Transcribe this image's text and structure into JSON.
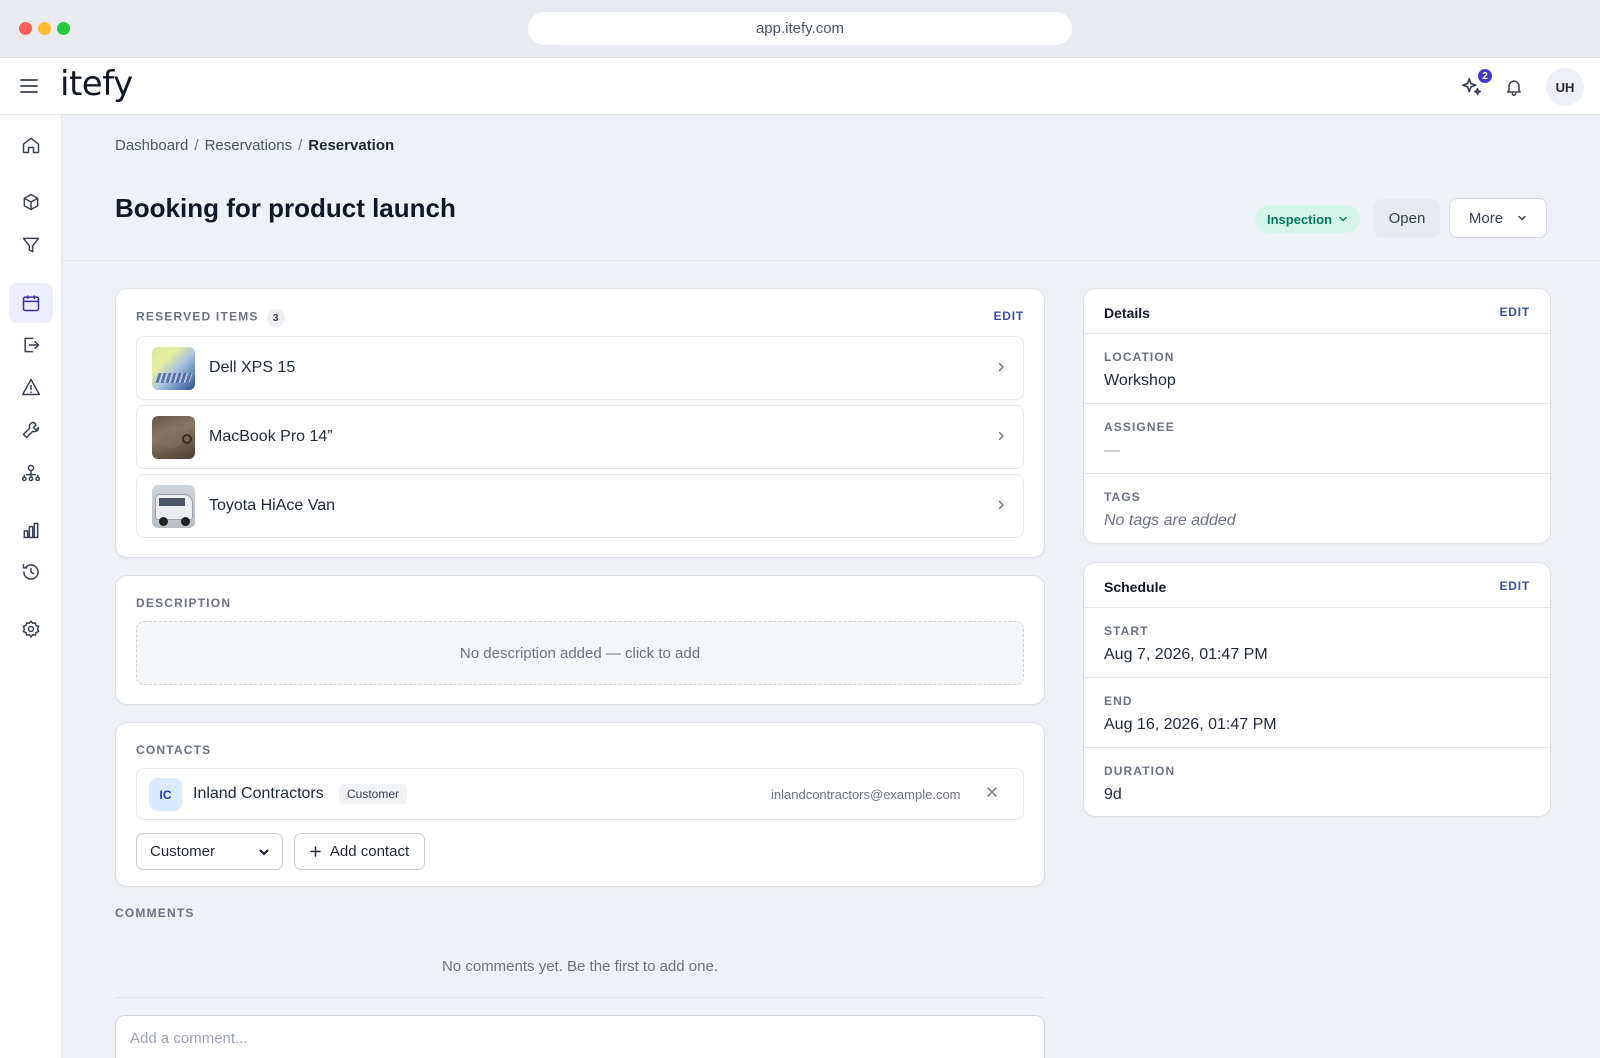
{
  "browser": {
    "url": "app.itefy.com"
  },
  "app": {
    "logo": "itefy",
    "notification_count": "2",
    "user_initials": "UH"
  },
  "breadcrumb": {
    "items": [
      "Dashboard",
      "Reservations"
    ],
    "current": "Reservation",
    "separator": "/"
  },
  "page": {
    "title": "Booking for product launch"
  },
  "actions": {
    "status": "Inspection",
    "open": "Open",
    "more": "More"
  },
  "reserved_items": {
    "label": "RESERVED ITEMS",
    "count": "3",
    "edit": "EDIT",
    "items": [
      {
        "name": "Dell XPS 15"
      },
      {
        "name": "MacBook Pro 14”"
      },
      {
        "name": "Toyota HiAce Van"
      }
    ]
  },
  "description": {
    "label": "DESCRIPTION",
    "placeholder": "No description added — click to add"
  },
  "contacts": {
    "label": "CONTACTS",
    "items": [
      {
        "initials": "IC",
        "name": "Inland Contractors",
        "role": "Customer",
        "email": "inlandcontractors@example.com"
      }
    ],
    "role_select": "Customer",
    "add_label": "Add contact"
  },
  "comments": {
    "label": "COMMENTS",
    "empty": "No comments yet. Be the first to add one.",
    "placeholder": "Add a comment..."
  },
  "details": {
    "title": "Details",
    "edit": "EDIT",
    "location_label": "LOCATION",
    "location": "Workshop",
    "assignee_label": "ASSIGNEE",
    "assignee": "—",
    "tags_label": "TAGS",
    "tags": "No tags are added"
  },
  "schedule": {
    "title": "Schedule",
    "edit": "EDIT",
    "start_label": "START",
    "start": "Aug 7, 2026, 01:47 PM",
    "end_label": "END",
    "end": "Aug 16, 2026, 01:47 PM",
    "duration_label": "DURATION",
    "duration": "9d"
  },
  "colors": {
    "accent": "#3730a3",
    "status_bg": "#d6f5ea",
    "status_text": "#047857",
    "edit_link": "#3b4fa8"
  },
  "icons": {
    "sidebar": [
      "home-icon",
      "box-icon",
      "filter-icon",
      "calendar-icon",
      "checkout-icon",
      "alert-icon",
      "wrench-icon",
      "users-icon",
      "chart-icon",
      "history-icon",
      "settings-icon"
    ]
  }
}
